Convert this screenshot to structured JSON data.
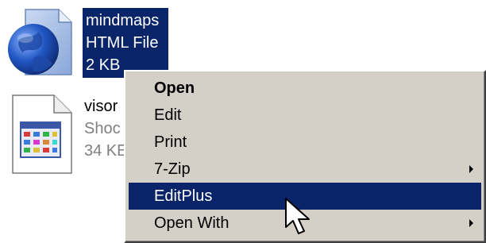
{
  "files": [
    {
      "name": "mindmaps",
      "type": "HTML File",
      "size": "2 KB",
      "icon": "html-document-icon",
      "selected": true
    },
    {
      "name": "visor",
      "type": "Shoc",
      "size": "34 KE",
      "icon": "flash-movie-icon",
      "selected": false
    }
  ],
  "context_menu": {
    "items": [
      {
        "label": "Open",
        "bold": true,
        "submenu": false
      },
      {
        "label": "Edit",
        "bold": false,
        "submenu": false
      },
      {
        "label": "Print",
        "bold": false,
        "submenu": false
      },
      {
        "label": "7-Zip",
        "bold": false,
        "submenu": true
      },
      {
        "label": "EditPlus",
        "bold": false,
        "submenu": false,
        "highlighted": true
      },
      {
        "label": "Open With",
        "bold": false,
        "submenu": true
      }
    ]
  },
  "colors": {
    "selection": "#0a246a",
    "menu_bg": "#d4d0c8",
    "desktop_bg": "#ffffff"
  }
}
